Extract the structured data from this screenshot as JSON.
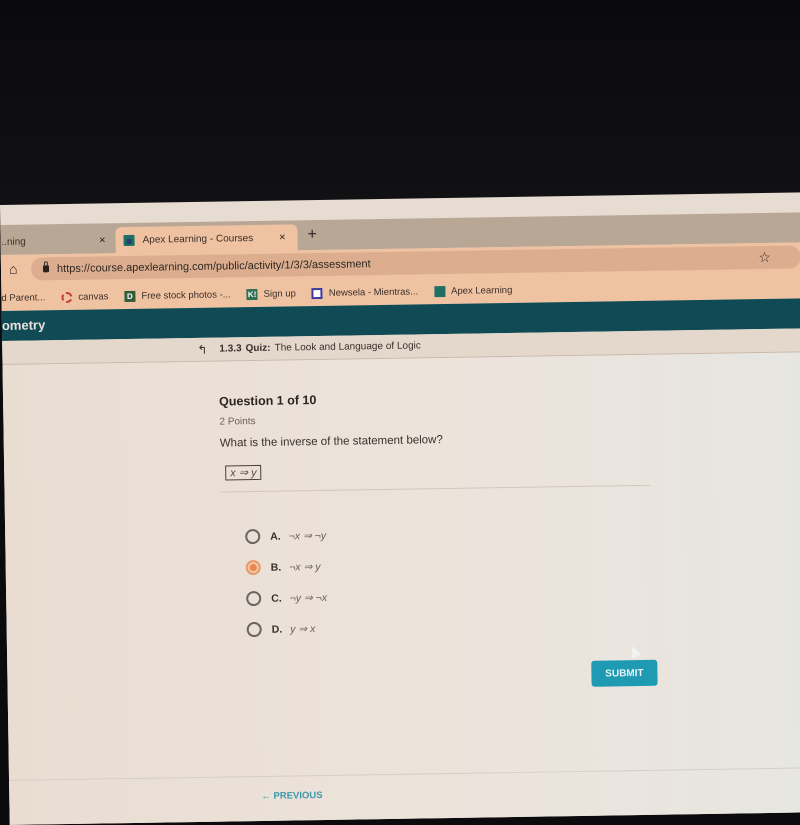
{
  "browser": {
    "tabs": [
      {
        "label": "...ning",
        "active": false
      },
      {
        "label": "Apex Learning - Courses",
        "active": true
      }
    ],
    "new_tab_symbol": "+",
    "close_symbol": "×",
    "url": "https://course.apexlearning.com/public/activity/1/3/3/assessment",
    "home_icon": "⌂",
    "star_icon": "☆",
    "bookmarks": [
      {
        "label": "d Parent...",
        "icon": "none"
      },
      {
        "label": "canvas",
        "icon": "canvas-icon"
      },
      {
        "label": "Free stock photos -...",
        "icon": "d-icon",
        "glyph": "D"
      },
      {
        "label": "Sign up",
        "icon": "k-icon",
        "glyph": "K!"
      },
      {
        "label": "Newsela - Mientras...",
        "icon": "newsela-icon"
      },
      {
        "label": "Apex Learning",
        "icon": "apex-icon"
      }
    ]
  },
  "course": {
    "title": "ometry"
  },
  "quiz": {
    "up_icon": "↰",
    "number": "1.3.3",
    "type": "Quiz:",
    "title": "The Look and Language of Logic"
  },
  "question": {
    "heading": "Question 1 of 10",
    "points": "2 Points",
    "text": "What is the inverse of the statement below?",
    "statement": "x ⇒ y",
    "options": [
      {
        "letter": "A.",
        "text": "¬x ⇒ ¬y",
        "selected": false
      },
      {
        "letter": "B.",
        "text": "¬x ⇒ y",
        "selected": true
      },
      {
        "letter": "C.",
        "text": "¬y ⇒ ¬x",
        "selected": false
      },
      {
        "letter": "D.",
        "text": "y ⇒ x",
        "selected": false
      }
    ]
  },
  "actions": {
    "submit_label": "SUBMIT",
    "previous_label": "← PREVIOUS"
  },
  "colors": {
    "course_bar": "#0f4a55",
    "submit": "#1e9ab3",
    "selected_radio": "#e8864c"
  }
}
